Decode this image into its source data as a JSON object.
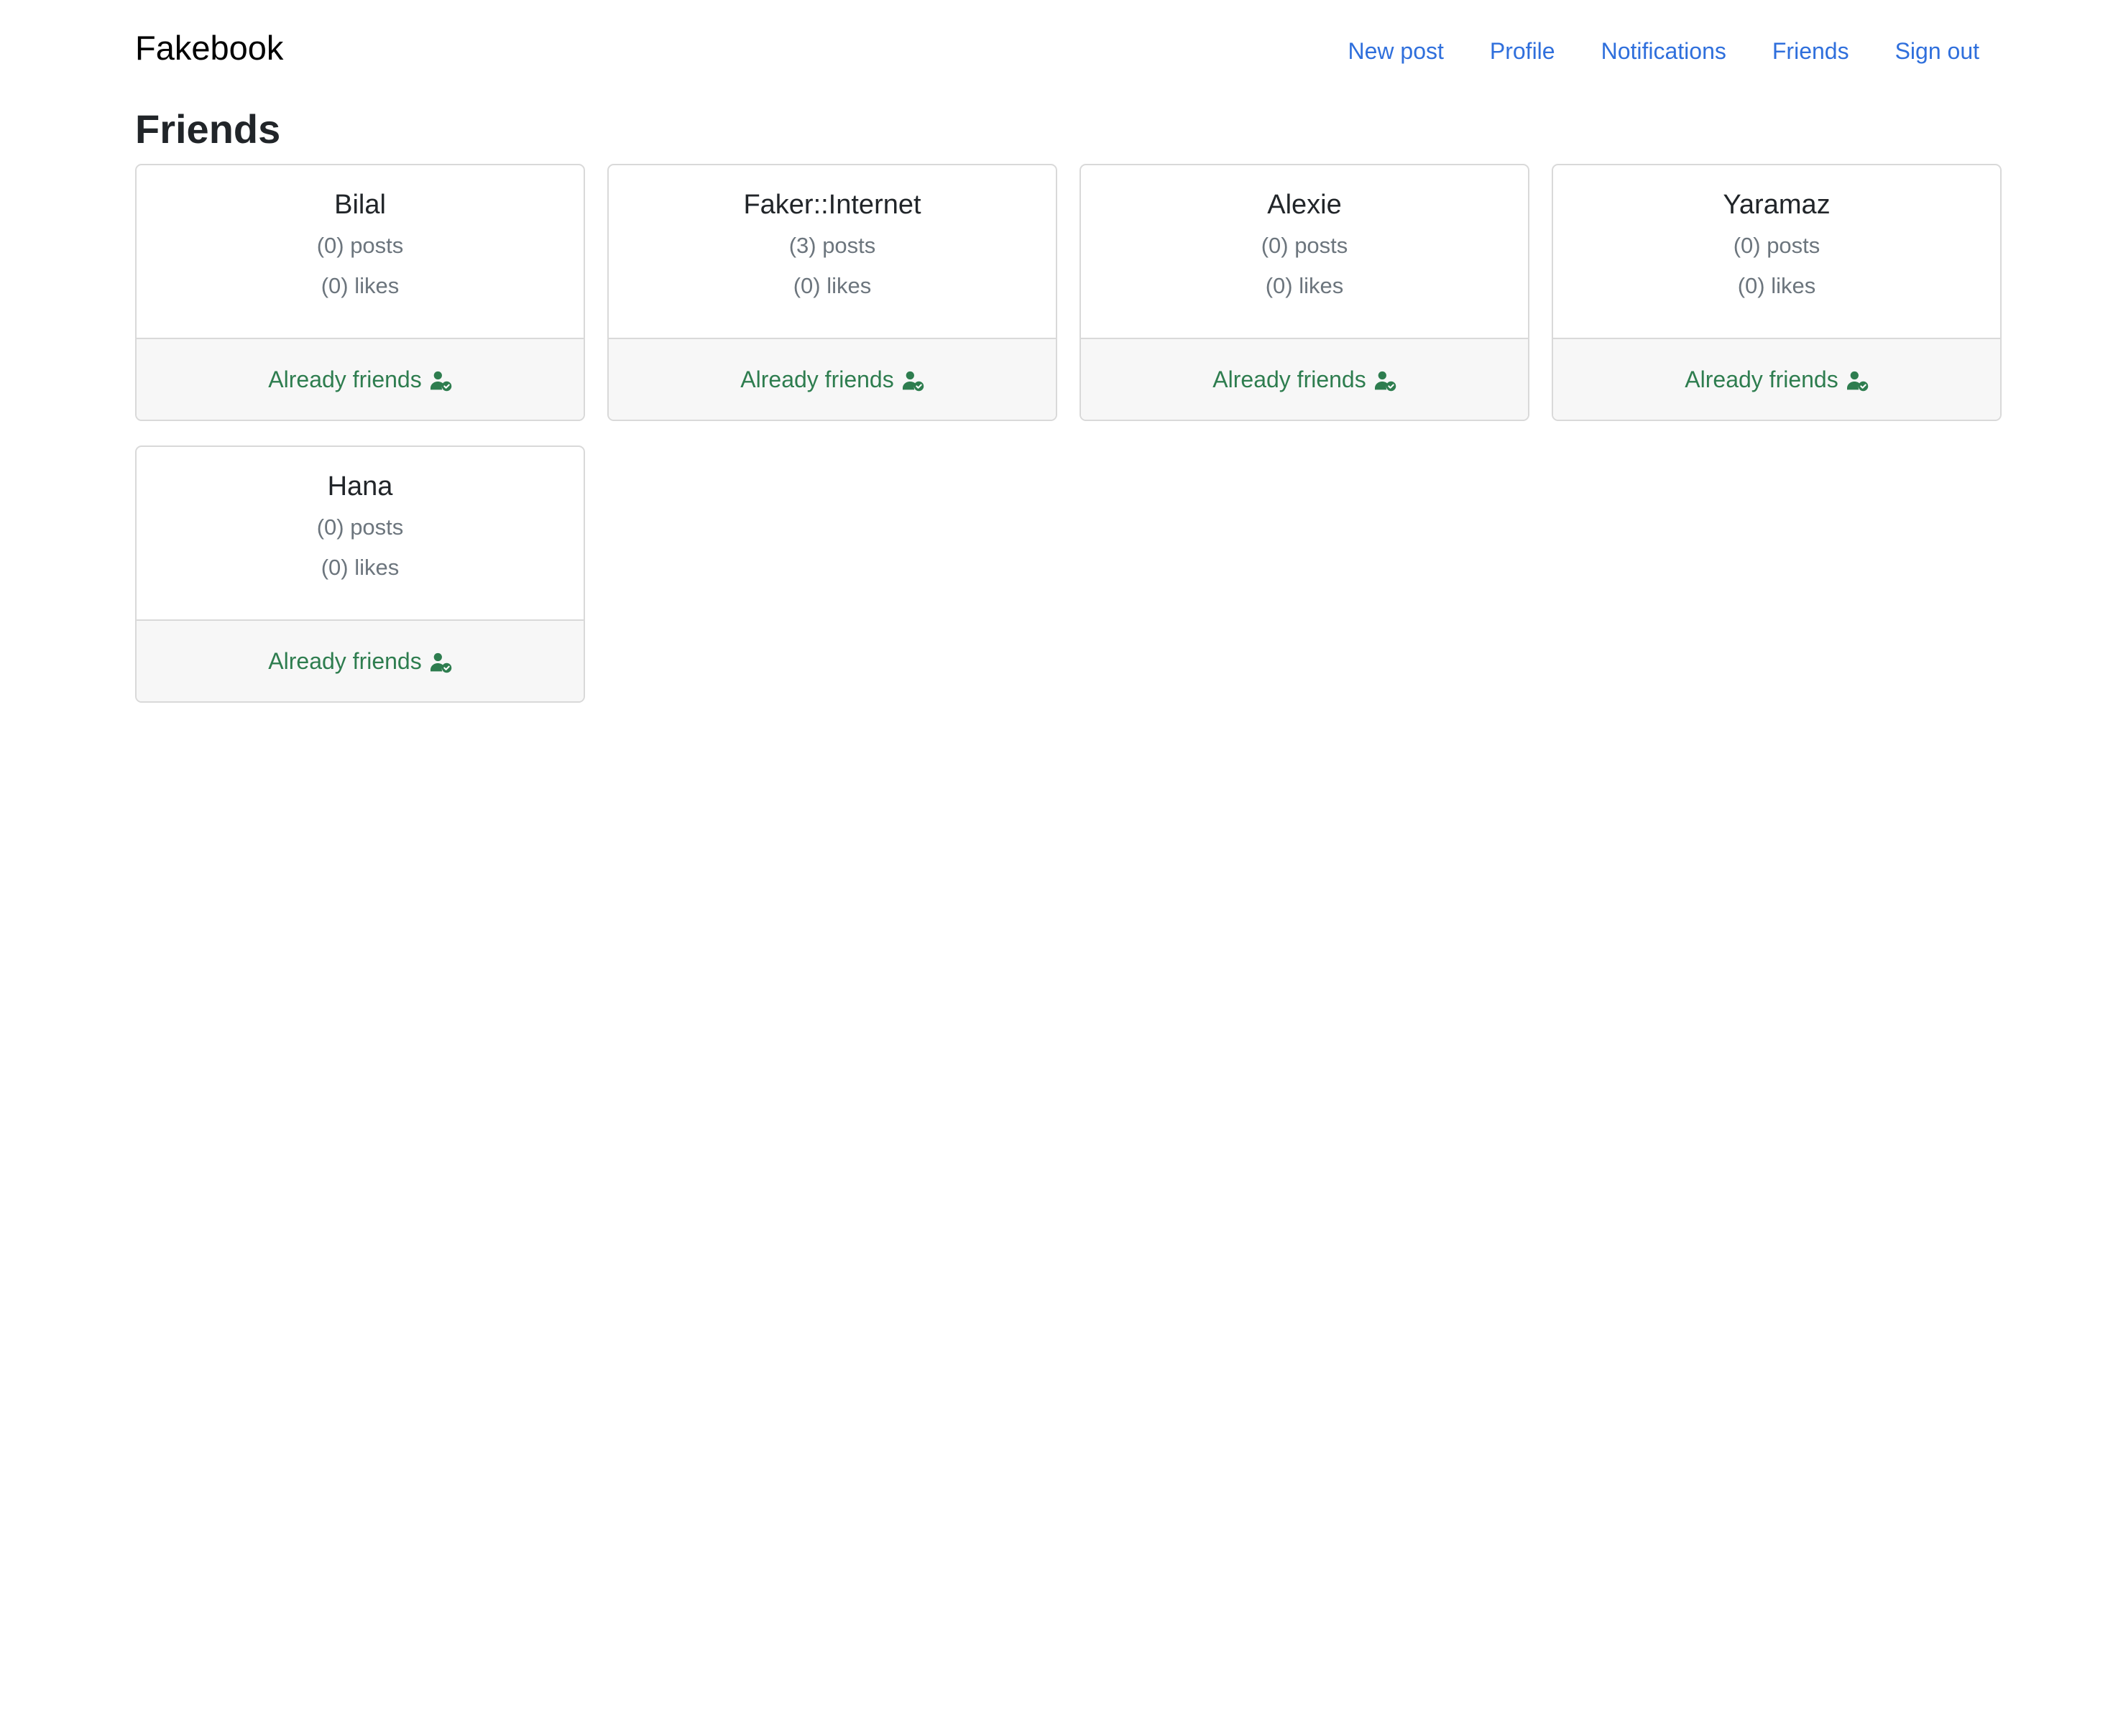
{
  "header": {
    "brand": "Fakebook",
    "nav": [
      {
        "label": "New post",
        "name": "nav-new-post"
      },
      {
        "label": "Profile",
        "name": "nav-profile"
      },
      {
        "label": "Notifications",
        "name": "nav-notifications"
      },
      {
        "label": "Friends",
        "name": "nav-friends"
      },
      {
        "label": "Sign out",
        "name": "nav-sign-out"
      }
    ]
  },
  "page": {
    "title": "Friends"
  },
  "friends": [
    {
      "name": "Bilal",
      "posts": "(0) posts",
      "likes": "(0) likes",
      "status": "Already friends",
      "icon": "user-check-icon"
    },
    {
      "name": "Faker::Internet",
      "posts": "(3) posts",
      "likes": "(0) likes",
      "status": "Already friends",
      "icon": "user-check-icon"
    },
    {
      "name": "Alexie",
      "posts": "(0) posts",
      "likes": "(0) likes",
      "status": "Already friends",
      "icon": "user-check-icon"
    },
    {
      "name": "Yaramaz",
      "posts": "(0) posts",
      "likes": "(0) likes",
      "status": "Already friends",
      "icon": "user-check-icon"
    },
    {
      "name": "Hana",
      "posts": "(0) posts",
      "likes": "(0) likes",
      "status": "Already friends",
      "icon": "user-check-icon"
    }
  ],
  "colors": {
    "link": "#2f6fdc",
    "success": "#2e7d4f",
    "muted": "#6c757d",
    "card_border": "#d9d9d9",
    "card_footer_bg": "#f7f7f7"
  }
}
